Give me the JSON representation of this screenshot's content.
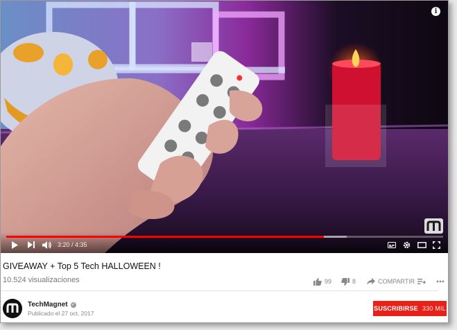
{
  "player": {
    "current_time": "3:20",
    "duration": "4:35",
    "time_separator": " / ",
    "progress_fraction": 0.727,
    "buffered_fraction": 0.78,
    "info_label": "i",
    "watermark": "m"
  },
  "video": {
    "title": "GIVEAWAY + Top 5 Tech HALLOWEEN !",
    "views": "10.524 visualizaciones"
  },
  "actions": {
    "likes": "99",
    "dislikes": "8",
    "share_label": "COMPARTIR"
  },
  "channel": {
    "name": "TechMagnet",
    "verified_mark": "✓",
    "published": "Publicado el 27 oct. 2017",
    "avatar_letter": "m"
  },
  "subscribe": {
    "label": "SUSCRIBIRSE",
    "count": "330 MIL"
  },
  "colors": {
    "progress": "#ff0000",
    "subscribe_bg": "#e62117"
  }
}
